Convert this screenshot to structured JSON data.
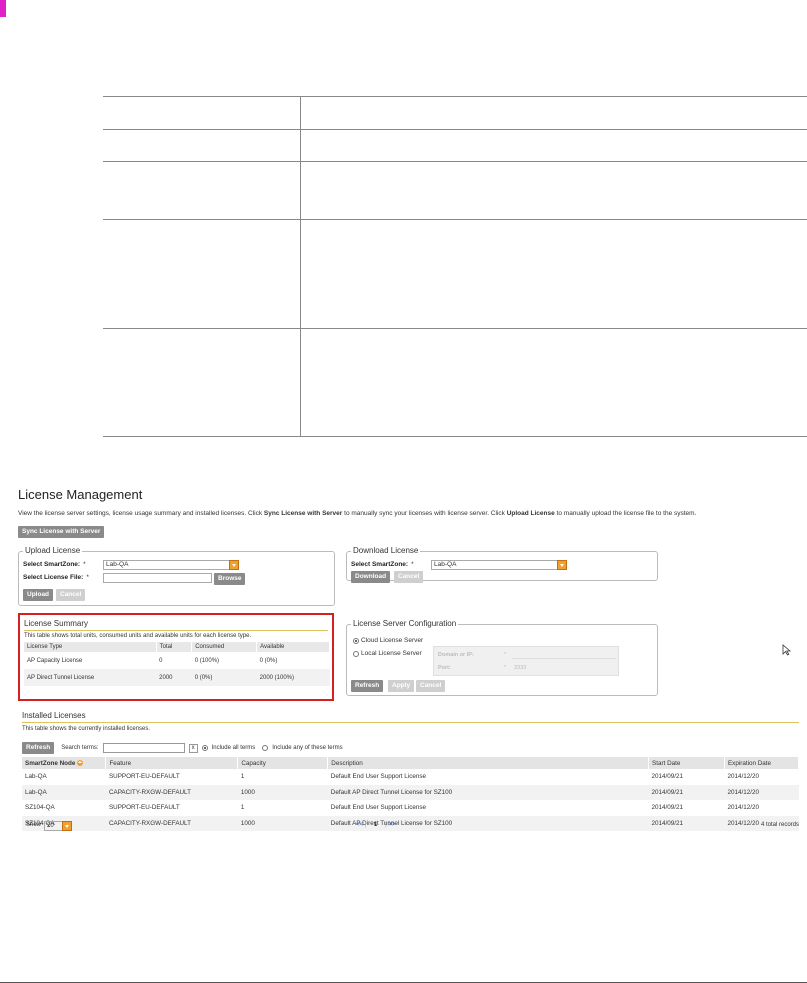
{
  "page": {
    "title": "License Management",
    "description_parts": [
      "View the license server settings, license usage summary and installed licenses. Click ",
      "Sync License with Server",
      " to manually sync your licenses with license server. Click ",
      "Upload License",
      " to manually upload the license file to the system."
    ],
    "sync_button": "Sync License with Server"
  },
  "upload": {
    "legend": "Upload License",
    "smartzone_label": "Select SmartZone:",
    "smartzone_value": "Lab-QA",
    "file_label": "Select License File:",
    "required": "*",
    "browse": "Browse",
    "upload": "Upload",
    "cancel": "Cancel"
  },
  "download": {
    "legend": "Download License",
    "smartzone_label": "Select SmartZone:",
    "smartzone_value": "Lab-QA",
    "required": "*",
    "download": "Download",
    "cancel": "Cancel"
  },
  "summary": {
    "title": "License Summary",
    "desc": "This table shows total units, consumed units and available units for each license type.",
    "columns": [
      "License Type",
      "Total",
      "Consumed",
      "Available"
    ],
    "rows": [
      [
        "AP Capacity License",
        "0",
        "0 (100%)",
        "0 (0%)"
      ],
      [
        "AP Direct Tunnel License",
        "2000",
        "0 (0%)",
        "2000 (100%)"
      ]
    ]
  },
  "server_config": {
    "legend": "License Server Configuration",
    "cloud": "Cloud License Server",
    "local": "Local License Server",
    "domain_label": "Domain or IP:",
    "port_label": "Port:",
    "port_value": "3333",
    "required": "*",
    "refresh": "Refresh",
    "apply": "Apply",
    "cancel": "Cancel"
  },
  "installed": {
    "title": "Installed Licenses",
    "desc": "This table shows the currently installed licenses.",
    "refresh": "Refresh",
    "search_label": "Search terms:",
    "clear": "x",
    "opt_all": "Include all terms",
    "opt_any": "Include any of these terms",
    "columns": [
      "SmartZone Node",
      "Feature",
      "Capacity",
      "Description",
      "Start Date",
      "Expiration Date"
    ],
    "rows": [
      [
        "Lab-QA",
        "SUPPORT-EU-DEFAULT",
        "1",
        "Default End User Support License",
        "2014/09/21",
        "2014/12/20"
      ],
      [
        "Lab-QA",
        "CAPACITY-RXGW-DEFAULT",
        "1000",
        "Default AP Direct Tunnel License for SZ100",
        "2014/09/21",
        "2014/12/20"
      ],
      [
        "SZ104-QA",
        "SUPPORT-EU-DEFAULT",
        "1",
        "Default End User Support License",
        "2014/09/21",
        "2014/12/20"
      ],
      [
        "SZ104-QA",
        "CAPACITY-RXGW-DEFAULT",
        "1000",
        "Default AP Direct Tunnel License for SZ100",
        "2014/09/21",
        "2014/12/20"
      ]
    ],
    "show_label": "Show",
    "show_value": "20",
    "prev": "<<",
    "page": "1",
    "next": ">>",
    "total": "4 total records"
  },
  "colors": {
    "highlight_border": "#d62020",
    "accent_orange": "#f0a030",
    "button_gray": "#8a8a8a"
  }
}
